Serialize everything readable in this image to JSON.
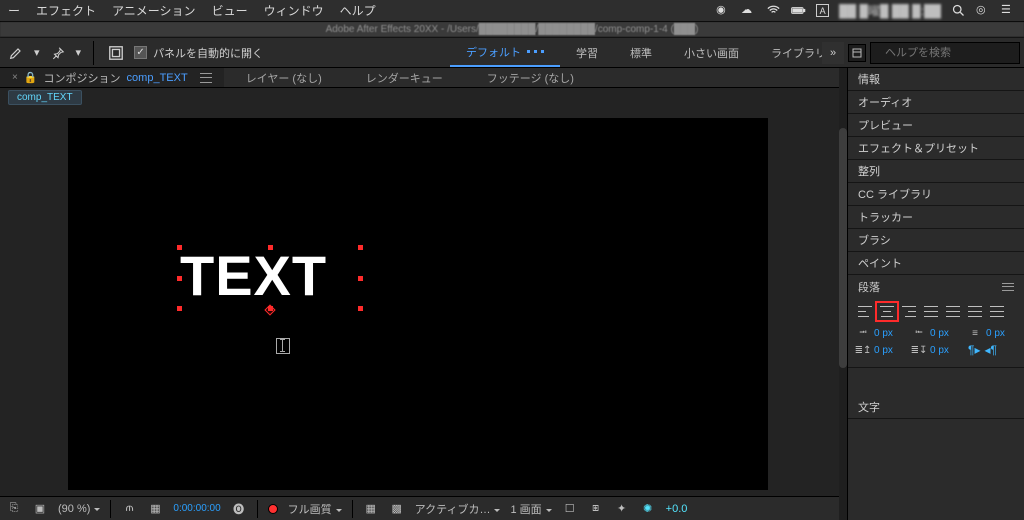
{
  "os_menu": {
    "items": [
      "ー",
      "エフェクト",
      "アニメーション",
      "ビュー",
      "ウィンドウ",
      "ヘルプ"
    ],
    "clock": "██ █曜█ ██ █:██"
  },
  "titlebar": "Adobe After Effects 20XX  -  /Users/████████/████████/comp-comp-1-4 (███)",
  "toolbar": {
    "auto_open_label": "パネルを自動的に開く",
    "workspaces": [
      "デフォルト",
      "学習",
      "標準",
      "小さい画面",
      "ライブラリ"
    ],
    "active_workspace": 0,
    "search_placeholder": "ヘルプを検索"
  },
  "dock": {
    "tabs": [
      {
        "prefix": "コンポジション",
        "link": "comp_TEXT",
        "active": true
      },
      {
        "label": "レイヤー (なし)"
      },
      {
        "label": "レンダーキュー"
      },
      {
        "label": "フッテージ (なし)"
      }
    ],
    "sub_tab": "comp_TEXT"
  },
  "stage": {
    "text": "TEXT"
  },
  "viewbar": {
    "zoom": "(90 %)",
    "timecode": "0:00:00:00",
    "quality": "フル画質",
    "camera": "アクティブカ…",
    "views": "1 画面",
    "exposure": "+0.0"
  },
  "side": {
    "rows": [
      "情報",
      "オーディオ",
      "プレビュー",
      "エフェクト＆プリセット",
      "整列",
      "CC ライブラリ",
      "トラッカー",
      "ブラシ",
      "ペイント"
    ],
    "paragraph": {
      "title": "段落",
      "indent_left": "0 px",
      "indent_right": "0 px",
      "first_line": "0 px",
      "space_before": "0 px",
      "space_after": "0 px"
    },
    "char_title": "文字"
  }
}
